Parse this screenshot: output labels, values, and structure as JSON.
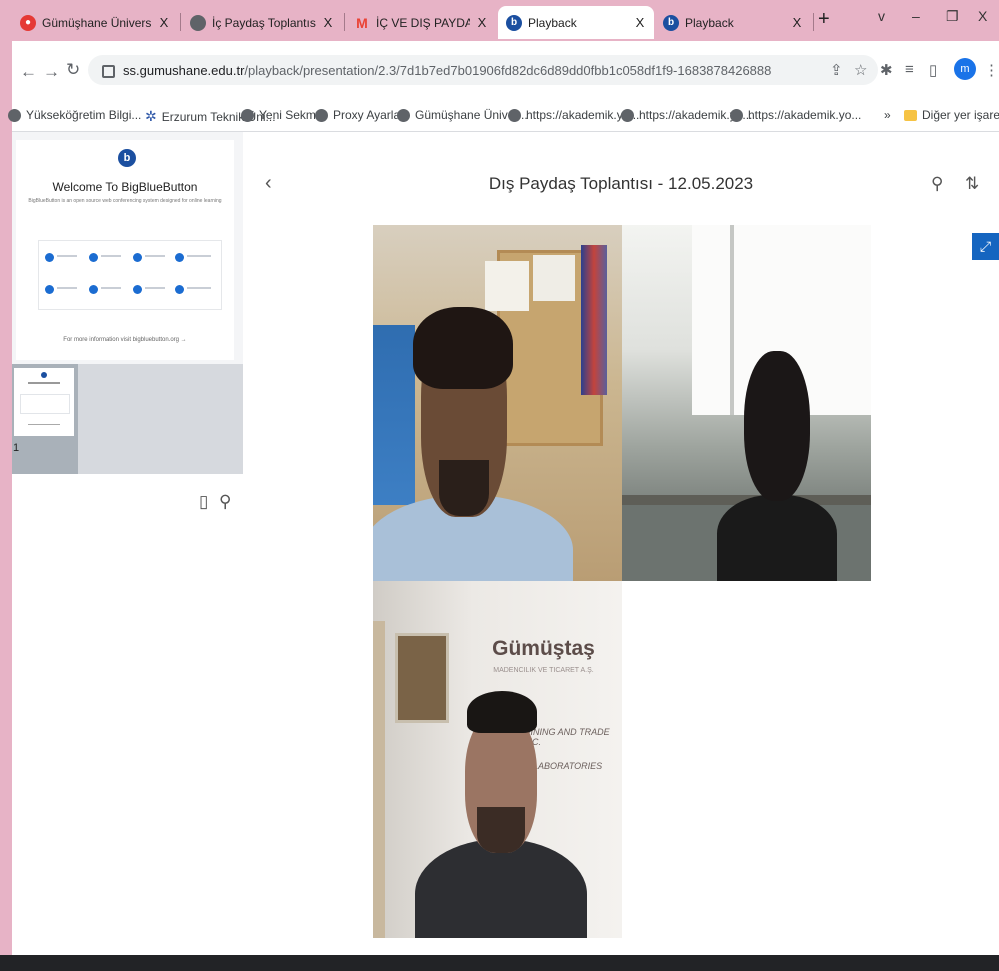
{
  "browser": {
    "tabs": [
      {
        "title": "Gümüşhane Üniversitesi - Ar",
        "icon": "location-pin-icon"
      },
      {
        "title": "İç Paydaş Toplantısı",
        "icon": "globe-icon"
      },
      {
        "title": "İÇ VE DIŞ PAYDAŞ TOPLANTI",
        "icon": "gmail-icon"
      },
      {
        "title": "Playback",
        "icon": "bigbluebutton-icon",
        "active": true
      },
      {
        "title": "Playback",
        "icon": "bigbluebutton-icon"
      }
    ],
    "close_glyph": "X",
    "new_tab_glyph": "+",
    "window_controls": {
      "tab_search": "v",
      "minimize": "–",
      "restore": "❐",
      "close": "X"
    },
    "url_host": "ss.gumushane.edu.tr",
    "url_path": "/playback/presentation/2.3/7d1b7ed7b01906fd82dc6d89dd0fbb1c058df1f9-1683878426888",
    "profile_initial": "m",
    "bookmarks": [
      {
        "label": "Yükseköğretim Bilgi...",
        "icon": "globe-icon"
      },
      {
        "label": "Erzurum Teknik Üni...",
        "icon": "star-logo-icon"
      },
      {
        "label": "Yeni Sekme",
        "icon": "globe-icon"
      },
      {
        "label": "Proxy Ayarları",
        "icon": "globe-icon"
      },
      {
        "label": "Gümüşhane Üniver...",
        "icon": "globe-icon"
      },
      {
        "label": "https://akademik.yo...",
        "icon": "globe-icon"
      },
      {
        "label": "https://akademik.yo...",
        "icon": "globe-icon"
      },
      {
        "label": "https://akademik.yo...",
        "icon": "globe-icon"
      }
    ],
    "bookmarks_overflow": "»",
    "other_bookmarks": "Diğer yer işaretleri"
  },
  "player": {
    "title": "Dış Paydaş Toplantısı - 12.05.2023",
    "slide": {
      "welcome": "Welcome To BigBlueButton",
      "subtitle": "BigBlueButton is an open source web conferencing system designed for online learning",
      "more_info": "For more information visit bigbluebutton.org →"
    },
    "thumbnail_number": "1",
    "video_banner_brand": "Gümüştaş",
    "video_banner_line1": "MADENCILIK VE TICARET A.Ş.",
    "video_banner_line2": "MINING AND TRADE INC.",
    "video_banner_line3": "LABORATORIES"
  },
  "colors": {
    "accent": "#1565c0",
    "bbb_blue": "#1b4fa0",
    "frame_pink": "#e7b3c6"
  }
}
